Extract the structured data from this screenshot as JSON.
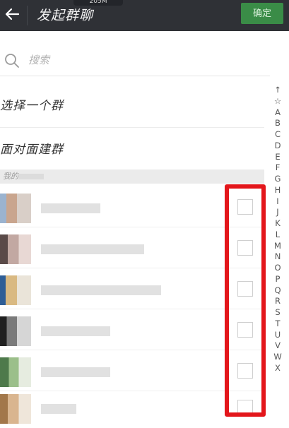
{
  "header": {
    "status_overlay_text": "205M",
    "title": "发起群聊",
    "confirm_label": "确定",
    "back_icon": "arrow-left-icon"
  },
  "search": {
    "icon": "search-icon",
    "placeholder": "搜索"
  },
  "menu": {
    "select_group": "选择一个群",
    "face_to_face": "面对面建群"
  },
  "section": {
    "label": "我的"
  },
  "contacts": [
    {
      "name_blurred": true,
      "checked": false,
      "avatar_colors": [
        "#9bb3cf",
        "#c9a58e",
        "#d9cfc8"
      ]
    },
    {
      "name_blurred": true,
      "checked": false,
      "avatar_colors": [
        "#5a4a48",
        "#c2a8a2",
        "#e8d8d4"
      ]
    },
    {
      "name_blurred": true,
      "checked": false,
      "avatar_colors": [
        "#2f5e96",
        "#d9b982",
        "#eae4d9"
      ]
    },
    {
      "name_blurred": true,
      "checked": false,
      "avatar_colors": [
        "#202020",
        "#7a7a7a",
        "#d6d6d6"
      ]
    },
    {
      "name_blurred": true,
      "checked": false,
      "avatar_colors": [
        "#4e7a4b",
        "#9bbf8a",
        "#e6ece0"
      ]
    },
    {
      "name_blurred": true,
      "checked": false,
      "avatar_colors": [
        "#a2774a",
        "#d9b58f",
        "#efe6da"
      ]
    }
  ],
  "index_letters": [
    "↑",
    "☆",
    "A",
    "B",
    "C",
    "D",
    "E",
    "F",
    "G",
    "H",
    "I",
    "J",
    "K",
    "L",
    "M",
    "N",
    "O",
    "P",
    "Q",
    "R",
    "S",
    "T",
    "U",
    "V",
    "W",
    "X"
  ],
  "colors": {
    "header_bg": "#2f3136",
    "confirm_bg": "#3a8c47",
    "highlight": "#e3161b"
  }
}
